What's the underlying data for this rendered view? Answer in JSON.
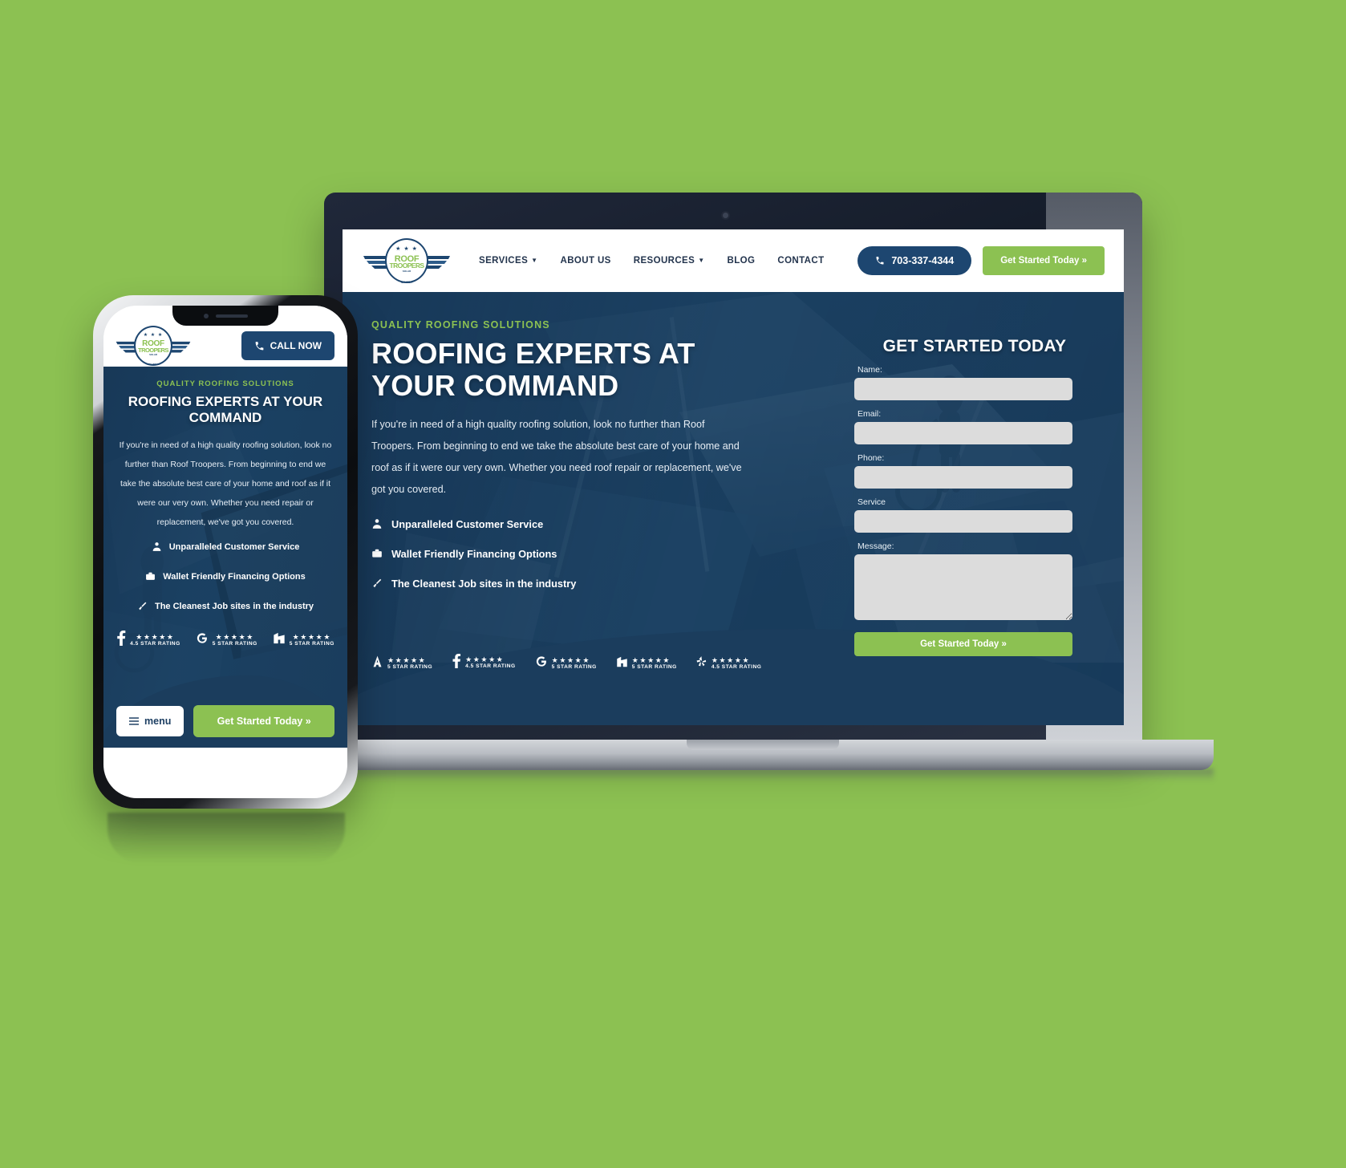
{
  "background_color": "#8cc152",
  "brand": {
    "name": "ROOF TROOPERS",
    "word_top": "ROOF",
    "word_bottom": "TROOPERS",
    "sub": "SOLAR",
    "byline": "BY WSA",
    "accent_green": "#8cc152",
    "navy": "#1d4670"
  },
  "desktop": {
    "header": {
      "logo_name": "roof-troopers-logo",
      "nav": [
        {
          "label": "SERVICES",
          "has_caret": true
        },
        {
          "label": "ABOUT US",
          "has_caret": false
        },
        {
          "label": "RESOURCES",
          "has_caret": true
        },
        {
          "label": "BLOG",
          "has_caret": false
        },
        {
          "label": "CONTACT",
          "has_caret": false
        }
      ],
      "phone_button": "703-337-4344",
      "cta_button": "Get Started Today »"
    },
    "hero": {
      "eyebrow": "QUALITY ROOFING SOLUTIONS",
      "heading": "ROOFING EXPERTS AT YOUR COMMAND",
      "paragraph": "If you're in need of a high quality roofing solution, look no further than Roof Troopers. From beginning to end we take the absolute best care of your home and roof as if it were our very own. Whether you need roof repair or replacement, we've got you covered.",
      "features": [
        {
          "icon": "person-icon",
          "label": "Unparalleled Customer Service"
        },
        {
          "icon": "wallet-icon",
          "label": "Wallet Friendly Financing Options"
        },
        {
          "icon": "broom-icon",
          "label": "The Cleanest Job sites in the industry"
        }
      ],
      "ratings": [
        {
          "brand": "angi",
          "stars": "★★★★★",
          "label": "5 STAR RATING"
        },
        {
          "brand": "facebook",
          "stars": "★★★★★",
          "label": "4.5 STAR RATING"
        },
        {
          "brand": "google",
          "stars": "★★★★★",
          "label": "5 STAR RATING"
        },
        {
          "brand": "homeadvisor",
          "stars": "★★★★★",
          "label": "5 STAR RATING"
        },
        {
          "brand": "yelp",
          "stars": "★★★★★",
          "label": "4.5 STAR RATING"
        }
      ]
    },
    "form": {
      "title": "GET STARTED TODAY",
      "fields": [
        {
          "label": "Name:",
          "value": "",
          "type": "text"
        },
        {
          "label": "Email:",
          "value": "",
          "type": "text"
        },
        {
          "label": "Phone:",
          "value": "",
          "type": "text"
        },
        {
          "label": "Service",
          "value": "",
          "type": "text"
        },
        {
          "label": "Message:",
          "value": "",
          "type": "textarea"
        }
      ],
      "submit": "Get Started Today »"
    }
  },
  "mobile": {
    "header": {
      "logo_name": "roof-troopers-logo",
      "call_button": "CALL NOW"
    },
    "hero": {
      "eyebrow": "QUALITY ROOFING SOLUTIONS",
      "heading": "ROOFING EXPERTS AT YOUR COMMAND",
      "paragraph": "If you're in need of a high quality roofing solution, look no further than Roof Troopers. From beginning to end we take the absolute best care of your home and roof as if it were our very own. Whether you need repair or replacement, we've got you covered.",
      "features": [
        {
          "icon": "person-icon",
          "label": "Unparalleled Customer Service"
        },
        {
          "icon": "wallet-icon",
          "label": "Wallet Friendly Financing Options"
        },
        {
          "icon": "broom-icon",
          "label": "The Cleanest Job sites in the industry"
        }
      ],
      "ratings": [
        {
          "brand": "facebook",
          "stars": "★★★★★",
          "label": "4.5 STAR RATING"
        },
        {
          "brand": "google",
          "stars": "★★★★★",
          "label": "5 STAR RATING"
        },
        {
          "brand": "homeadvisor",
          "stars": "★★★★★",
          "label": "5 STAR RATING"
        }
      ]
    },
    "bottom_bar": {
      "menu_button": "menu",
      "cta_button": "Get Started Today »"
    }
  }
}
